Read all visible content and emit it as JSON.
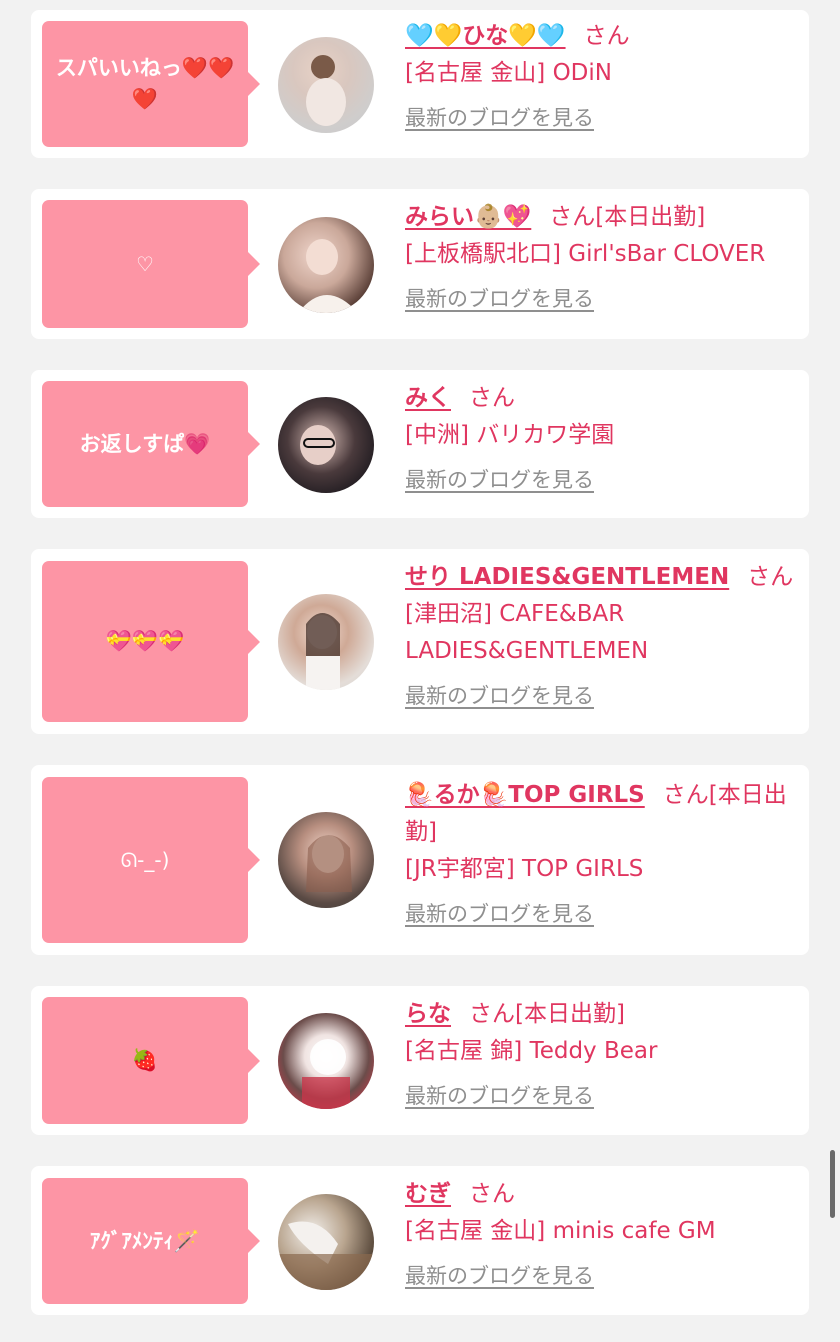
{
  "colors": {
    "accent": "#e03660",
    "bubble": "#fd95a5",
    "link_gray": "#8f8f8f",
    "background": "#f2f2f2"
  },
  "san_label": "さん",
  "blog_link_label": "最新のブログを見る",
  "cards": [
    {
      "message": "スパいいねっ❤️❤️❤️",
      "name": "🩵💛ひな💛🩵",
      "status": "",
      "shop": "[名古屋 金山] ODiN"
    },
    {
      "message": "♡",
      "name": "みらい👶🏼💖",
      "status": "[本日出勤]",
      "shop": "[上板橋駅北口] Girl'sBar CLOVER"
    },
    {
      "message": "お返しすぱ💗",
      "name": "みく",
      "status": "",
      "shop": "[中洲] バリカワ学園"
    },
    {
      "message": "💝💝💝",
      "name": "せり LADIES&GENTLEMEN",
      "status": "",
      "shop": "[津田沼] CAFE&BAR LADIES&GENTLEMEN"
    },
    {
      "message": "ᘏ-_-)",
      "name": "🪼るか🪼TOP GIRLS",
      "status": "[本日出勤]",
      "shop": "[JR宇都宮] TOP GIRLS"
    },
    {
      "message": "🍓",
      "name": "らな",
      "status": "[本日出勤]",
      "shop": "[名古屋 錦] Teddy Bear"
    },
    {
      "message": "ｱｸﾞｱﾒﾝﾃｨ🪄",
      "name": "むぎ",
      "status": "",
      "shop": "[名古屋 金山] minis cafe GM"
    }
  ]
}
